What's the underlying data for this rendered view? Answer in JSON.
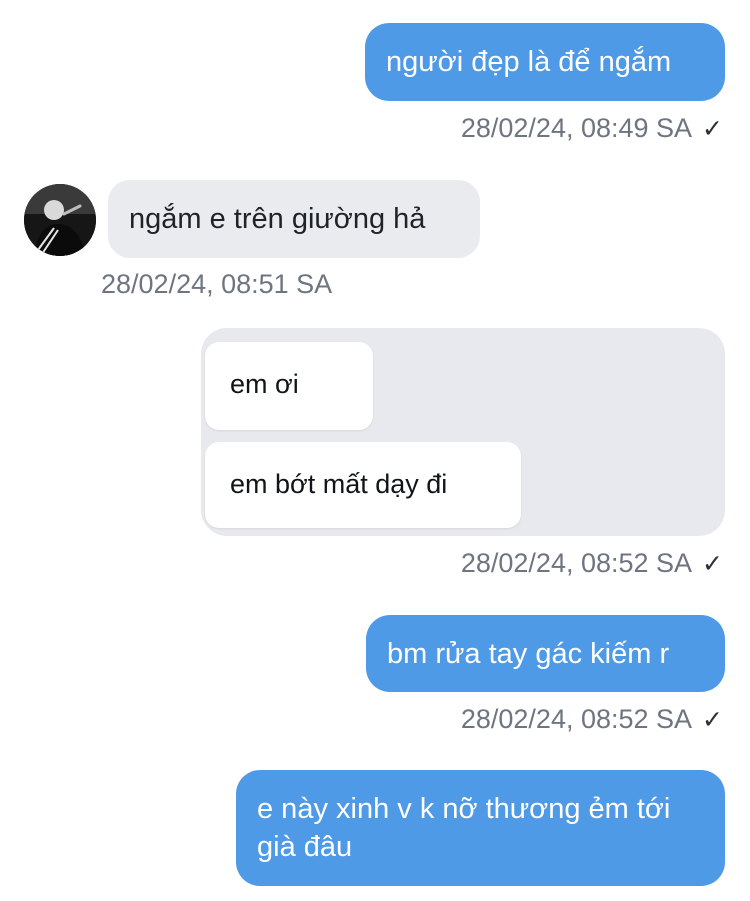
{
  "messages": [
    {
      "direction": "outgoing",
      "text": "người đẹp là để ngắm",
      "timestamp": "28/02/24, 08:49 SA",
      "status": "✓"
    },
    {
      "direction": "incoming",
      "text": "ngắm e trên giường hả",
      "timestamp": "28/02/24, 08:51 SA",
      "avatar": "user-avatar"
    },
    {
      "direction": "outgoing",
      "type": "image",
      "image_bubbles": [
        "em ơi",
        "em bớt mất dạy đi"
      ],
      "timestamp": "28/02/24, 08:52 SA",
      "status": "✓"
    },
    {
      "direction": "outgoing",
      "text": "bm rửa tay gác kiếm r",
      "timestamp": "28/02/24, 08:52 SA",
      "status": "✓"
    },
    {
      "direction": "outgoing",
      "text": "e này xinh v k nỡ thương ẻm tới già đâu"
    }
  ],
  "colors": {
    "outgoing_bubble": "#4f9ae6",
    "incoming_bubble": "#e9ebee",
    "timestamp_text": "#6e7480"
  }
}
